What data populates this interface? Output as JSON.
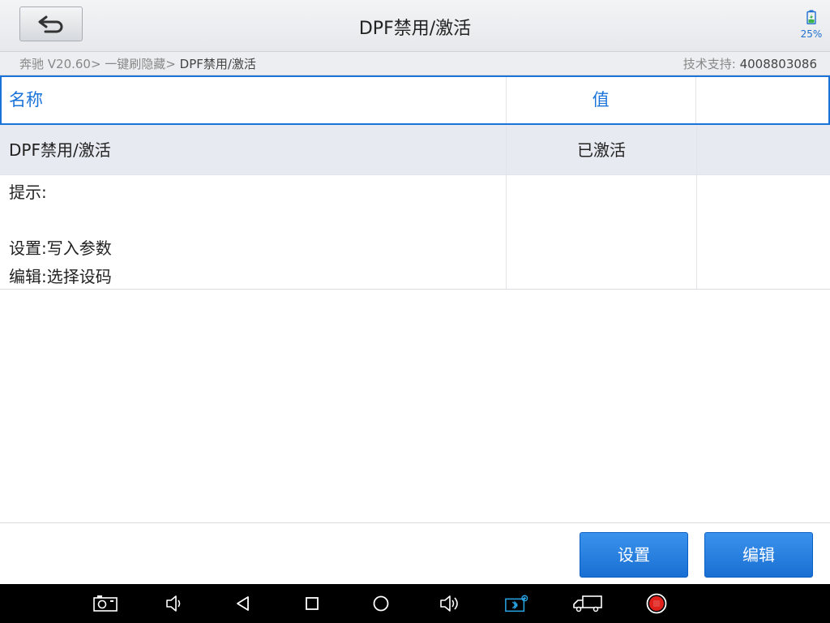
{
  "header": {
    "title": "DPF禁用/激活",
    "battery_percent": "25%"
  },
  "breadcrumb": {
    "path": "奔驰 V20.60> 一键刷隐藏> ",
    "current": "DPF禁用/激活"
  },
  "support": {
    "label": "技术支持:",
    "phone": "4008803086"
  },
  "table": {
    "headers": [
      "名称",
      "值",
      ""
    ],
    "rows": [
      {
        "name": "DPF禁用/激活",
        "value": "已激活",
        "extra": ""
      }
    ],
    "tips": {
      "title": "提示:",
      "line1": "设置:写入参数",
      "line2": "编辑:选择设码"
    }
  },
  "actions": {
    "set_label": "设置",
    "edit_label": "编辑"
  },
  "colors": {
    "accent": "#1a73d9",
    "button": "#1a6fd3",
    "selected_row": "#e7eaf0",
    "record_red": "#e0201b",
    "bluetooth": "#29a7e8"
  },
  "icons": {
    "nav": [
      "screenshot-icon",
      "volume-down-icon",
      "back-icon",
      "recents-icon",
      "home-icon",
      "volume-up-icon",
      "bluetooth-vci-icon",
      "truck-icon",
      "record-icon"
    ]
  }
}
